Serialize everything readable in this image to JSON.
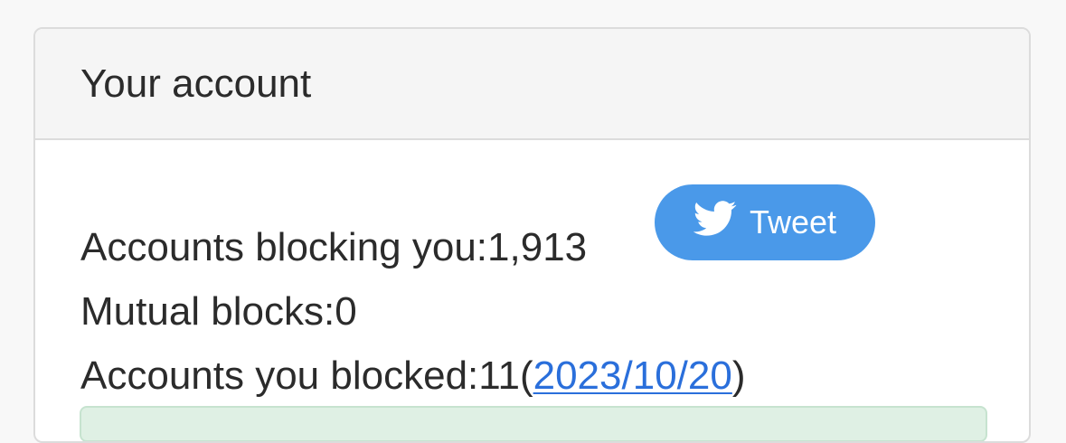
{
  "card": {
    "title": "Your account"
  },
  "stats": {
    "blocking_label": "Accounts blocking you:",
    "blocking_count": "1,913",
    "mutual_label": "Mutual blocks:",
    "mutual_count": "0",
    "blocked_label": "Accounts you blocked:",
    "blocked_count": "11",
    "blocked_paren_open": "(",
    "blocked_date": "2023/10/20",
    "blocked_paren_close": ")"
  },
  "tweet_button": {
    "label": "Tweet",
    "icon": "twitter-bird-icon",
    "color": "#4a99e9"
  },
  "colors": {
    "link": "#2a6fdb",
    "alert_bg": "#dff0e4"
  }
}
